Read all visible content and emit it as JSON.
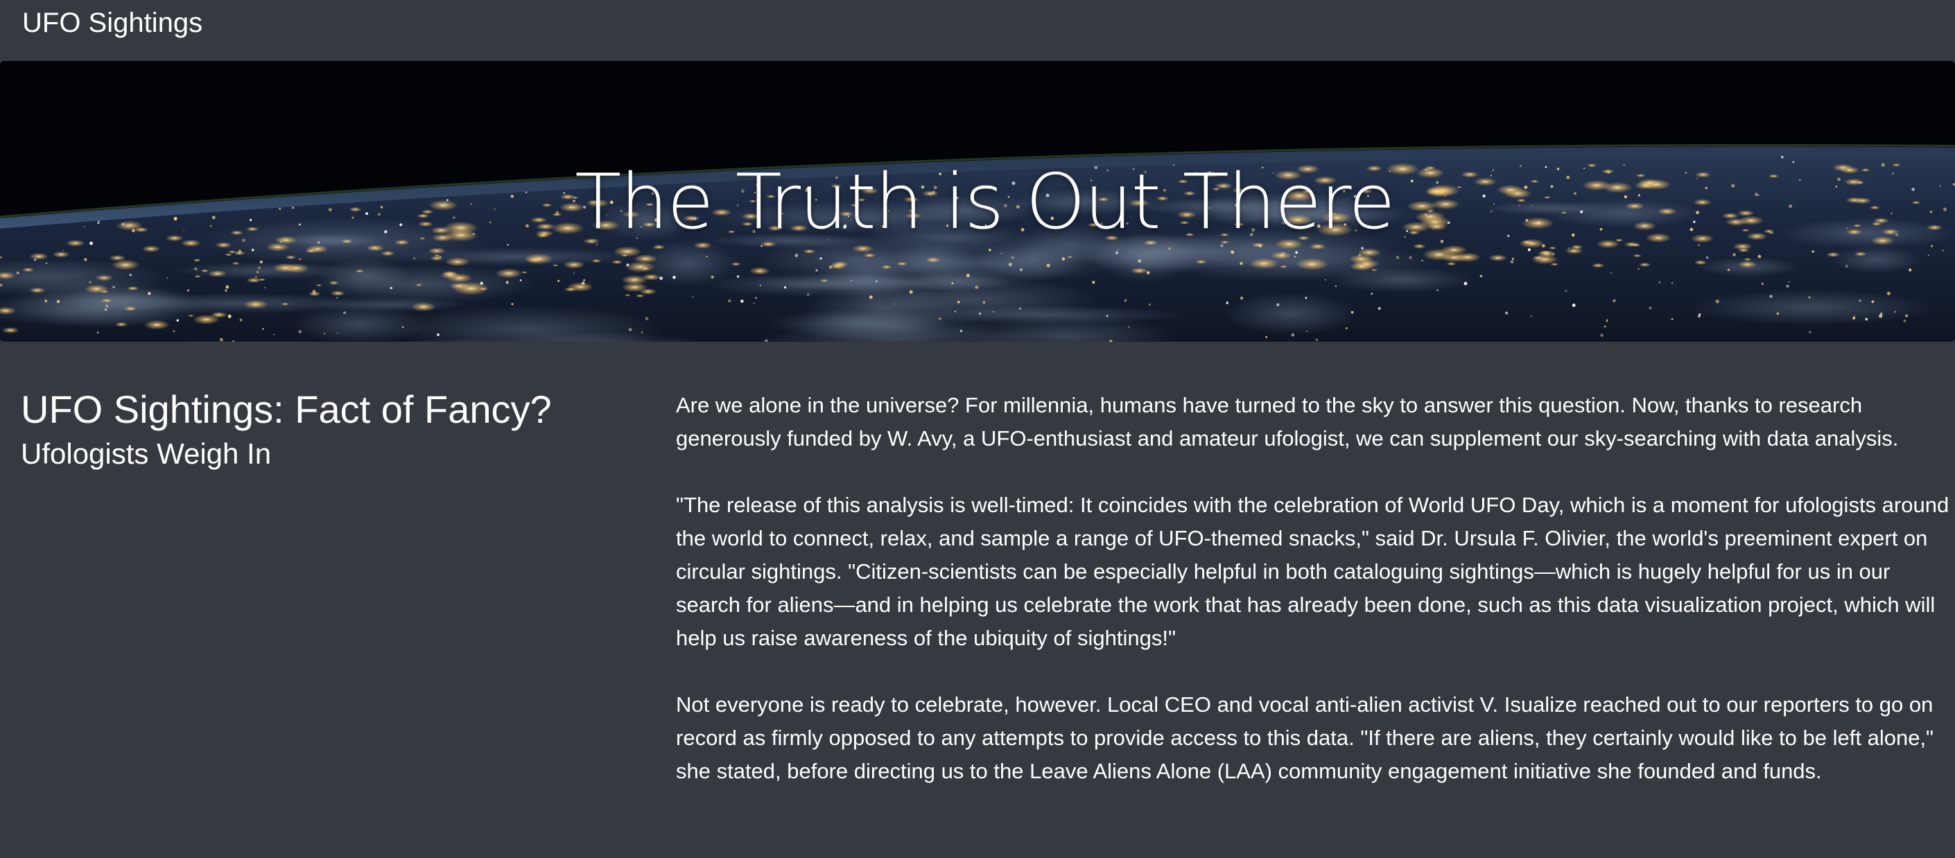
{
  "navbar": {
    "brand": "UFO Sightings"
  },
  "hero": {
    "title": "The Truth is Out There",
    "background_image": "earth-at-night-from-space"
  },
  "article": {
    "title": "UFO Sightings: Fact of Fancy?",
    "subtitle": "Ufologists Weigh In",
    "paragraphs": [
      "Are we alone in the universe? For millennia, humans have turned to the sky to answer this question. Now, thanks to research generously funded by W. Avy, a UFO-enthusiast and amateur ufologist, we can supplement our sky-searching with data analysis.",
      "\"The release of this analysis is well-timed: It coincides with the celebration of World UFO Day, which is a moment for ufologists around the world to connect, relax, and sample a range of UFO-themed snacks,\" said Dr. Ursula F. Olivier, the world's preeminent expert on circular sightings. \"Citizen-scientists can be especially helpful in both cataloguing sightings—which is hugely helpful for us in our search for aliens—and in helping us celebrate the work that has already been done, such as this data visualization project, which will help us raise awareness of the ubiquity of sightings!\"",
      "Not everyone is ready to celebrate, however. Local CEO and vocal anti-alien activist V. Isualize reached out to our reporters to go on record as firmly opposed to any attempts to provide access to this data. \"If there are aliens, they certainly would like to be left alone,\" she stated, before directing us to the Leave Aliens Alone (LAA) community engagement initiative she founded and funds."
    ]
  },
  "colors": {
    "background": "#343a40",
    "text": "#ffffff",
    "space": "#03050a"
  }
}
